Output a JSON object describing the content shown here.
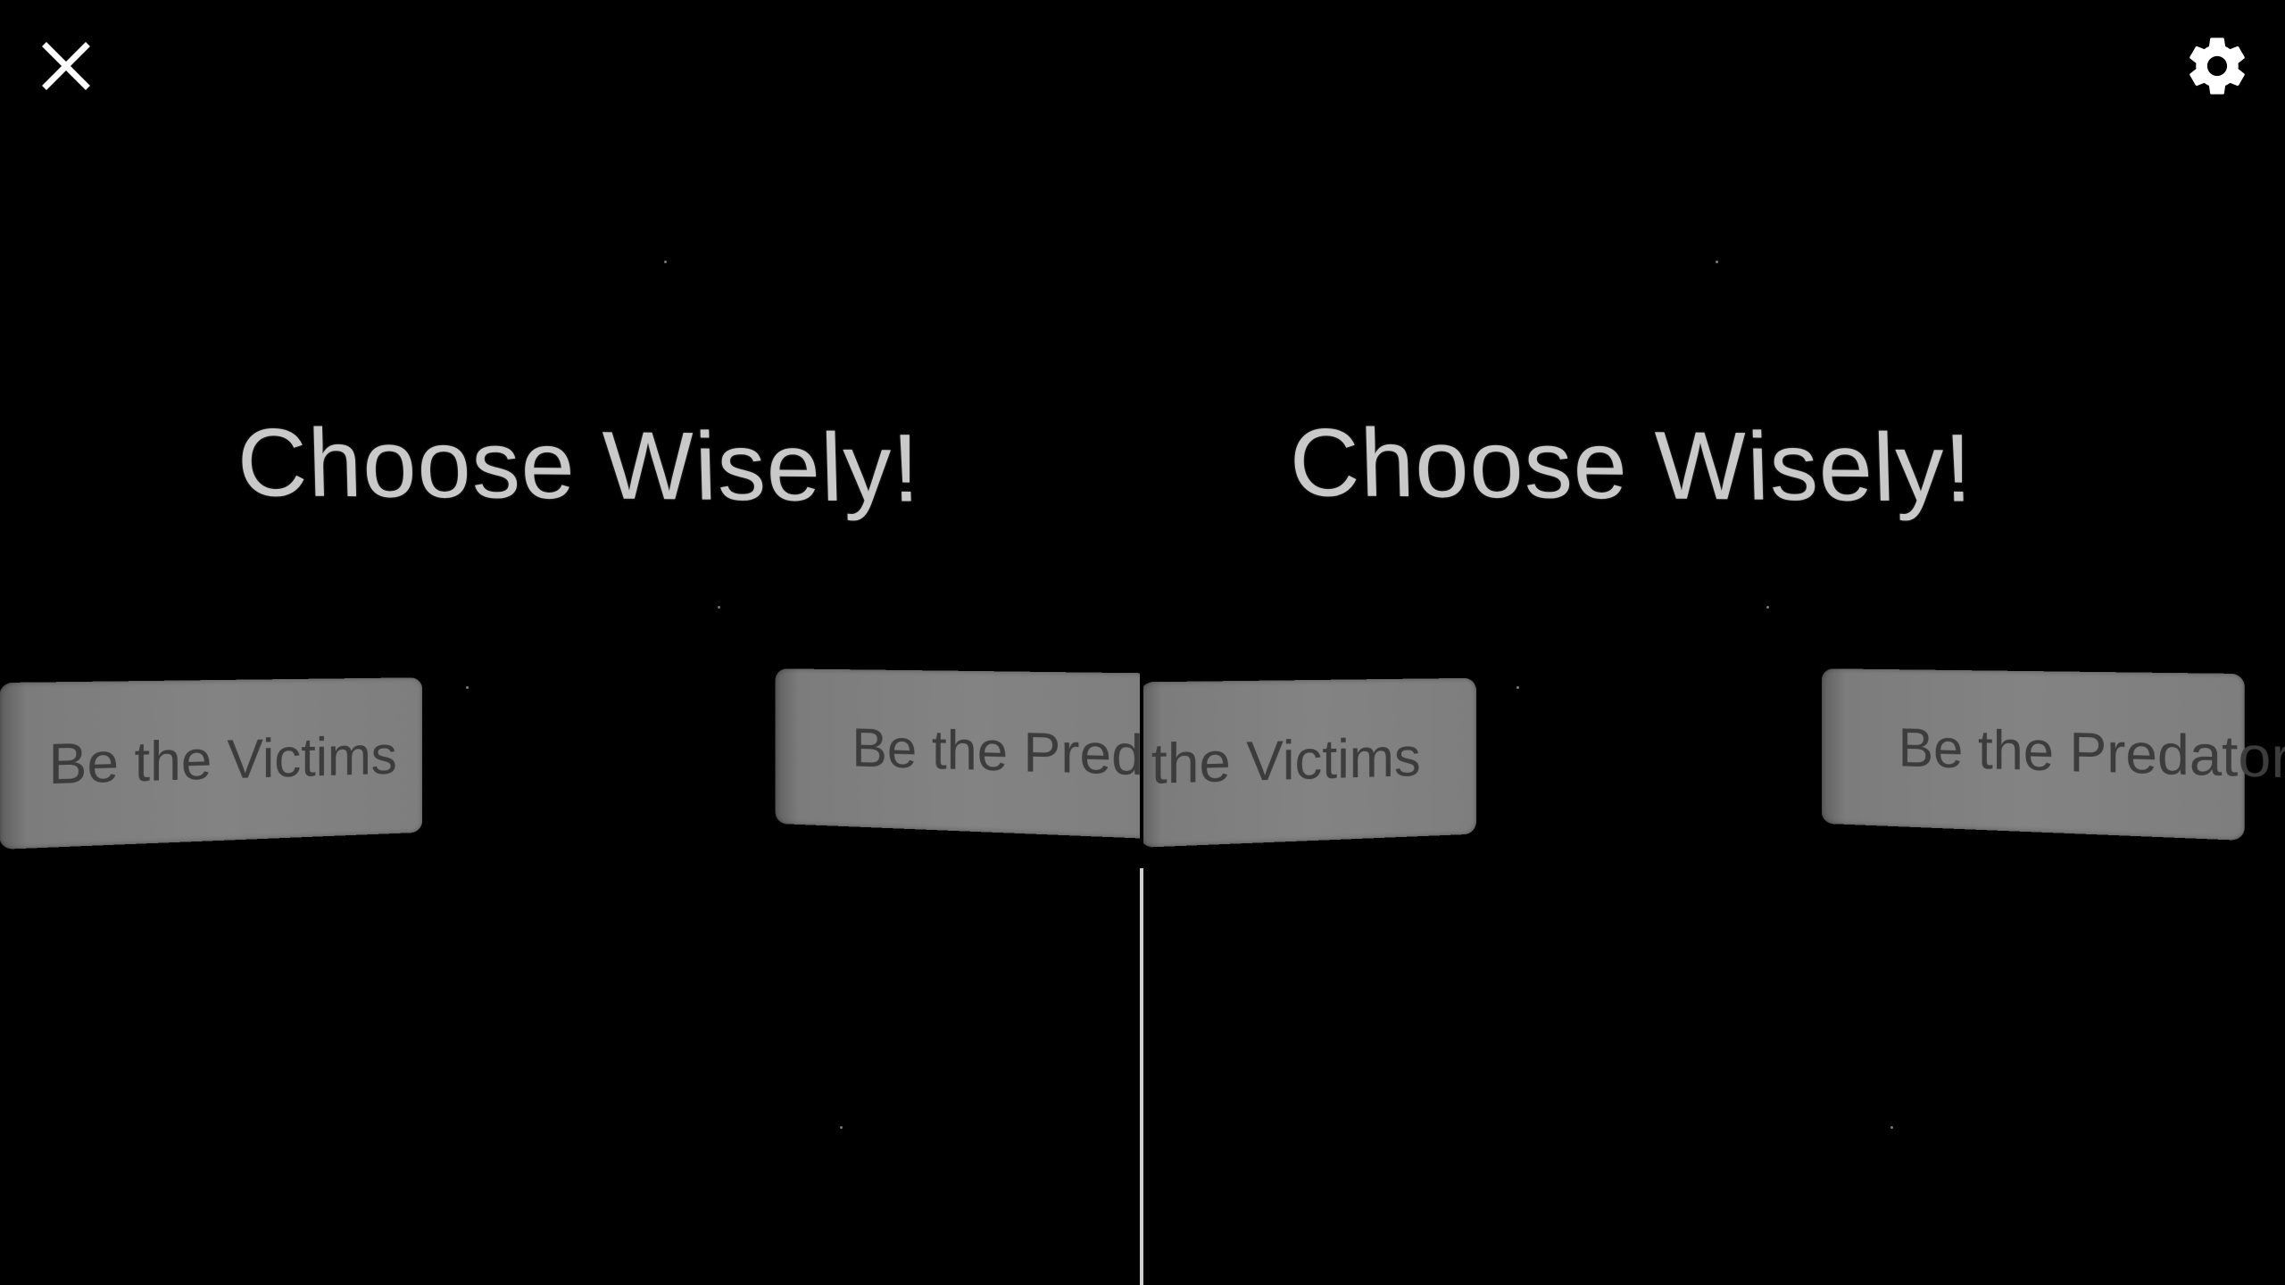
{
  "scene": {
    "title": "Choose Wisely!",
    "title_parts": [
      "C",
      "hoose ",
      "W",
      "isely!"
    ],
    "victims_label": "Be the Victims",
    "predator_label": "Be the Predator",
    "left_eye_victims_visible": "Be the Victims",
    "left_eye_predator_visible": "Be the Predato",
    "right_eye_victims_visible": "the Victims",
    "right_eye_predator_visible": "Be the Predator"
  },
  "controls": {
    "close_icon": "close-icon",
    "settings_icon": "gear-icon"
  },
  "colors": {
    "background": "#000000",
    "title_text": "#c9c9c9",
    "button_face": "#838383",
    "button_text": "#3c3c3c",
    "divider": "#cfcfcf",
    "icon": "#ffffff"
  }
}
